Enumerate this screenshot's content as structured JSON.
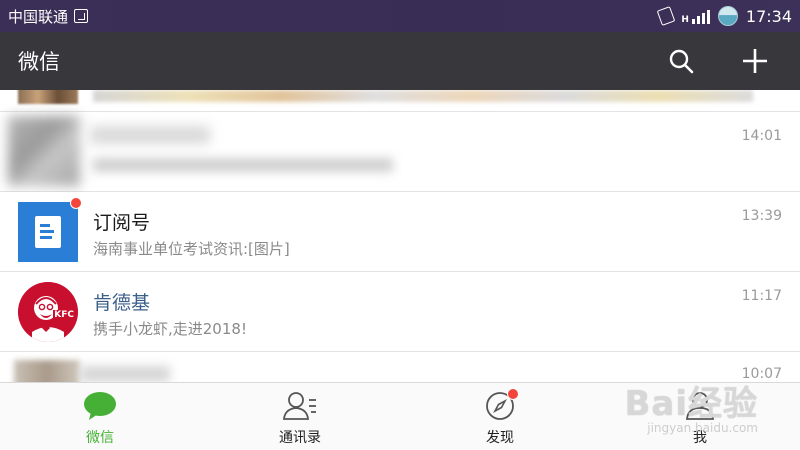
{
  "status_bar": {
    "carrier": "中国联通",
    "signal_label": "H",
    "time": "17:34"
  },
  "header": {
    "title": "微信",
    "icons": [
      "search-icon",
      "plus-icon"
    ]
  },
  "chats": [
    {
      "name": "",
      "preview": "",
      "time": ""
    },
    {
      "name": "",
      "preview": "",
      "time": "14:01"
    },
    {
      "name": "订阅号",
      "preview": "海南事业单位考试资讯:[图片]",
      "time": "13:39",
      "unread_dot": true
    },
    {
      "name": "肯德基",
      "preview": "携手小龙虾,走进2018!",
      "time": "11:17",
      "avatar_text": "KFC"
    },
    {
      "name": "",
      "preview": "",
      "time": "10:07"
    }
  ],
  "bottom_nav": [
    {
      "label": "微信",
      "icon": "chat-bubble-icon",
      "active": true
    },
    {
      "label": "通讯录",
      "icon": "contacts-icon",
      "active": false
    },
    {
      "label": "发现",
      "icon": "compass-icon",
      "active": false,
      "unread_dot": true
    },
    {
      "label": "我",
      "icon": "person-icon",
      "active": false
    }
  ],
  "watermark": {
    "text": "Bai经验",
    "url_text": "jingyan.baidu.com"
  },
  "colors": {
    "active_green": "#45b035",
    "header_bg": "#38373c",
    "status_bg": "#3b2e57",
    "badge_red": "#f2463d",
    "subscription_blue": "#2b7ed6",
    "kfc_red": "#c8102e"
  }
}
